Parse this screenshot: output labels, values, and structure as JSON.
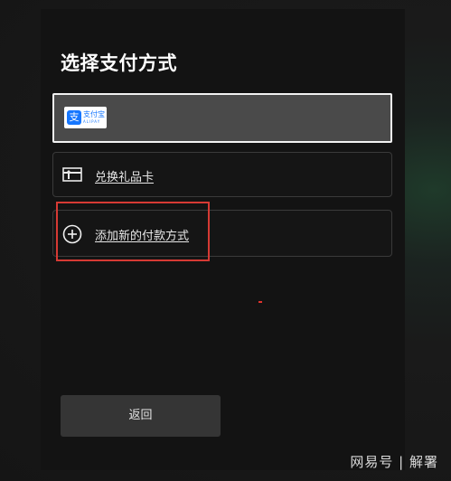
{
  "dialog": {
    "title": "选择支付方式",
    "options": [
      {
        "id": "alipay",
        "label": "",
        "logo_text": "支付宝",
        "logo_sub": "ALIPAY",
        "logo_mark": "支",
        "selected": true,
        "icon": "alipay-logo"
      },
      {
        "id": "gift",
        "label": "兑换礼品卡",
        "selected": false,
        "icon": "gift-card-icon"
      },
      {
        "id": "addnew",
        "label": "添加新的付款方式",
        "selected": false,
        "icon": "plus-circle-icon"
      }
    ],
    "back_label": "返回"
  },
  "watermark": "网易号 | 解署",
  "colors": {
    "panel": "#131313",
    "selected_bg": "#4a4a4a",
    "selected_border": "#f2f2f2",
    "highlight_red": "#d63a34",
    "alipay_blue": "#1677ff",
    "button_bg": "#353535"
  }
}
